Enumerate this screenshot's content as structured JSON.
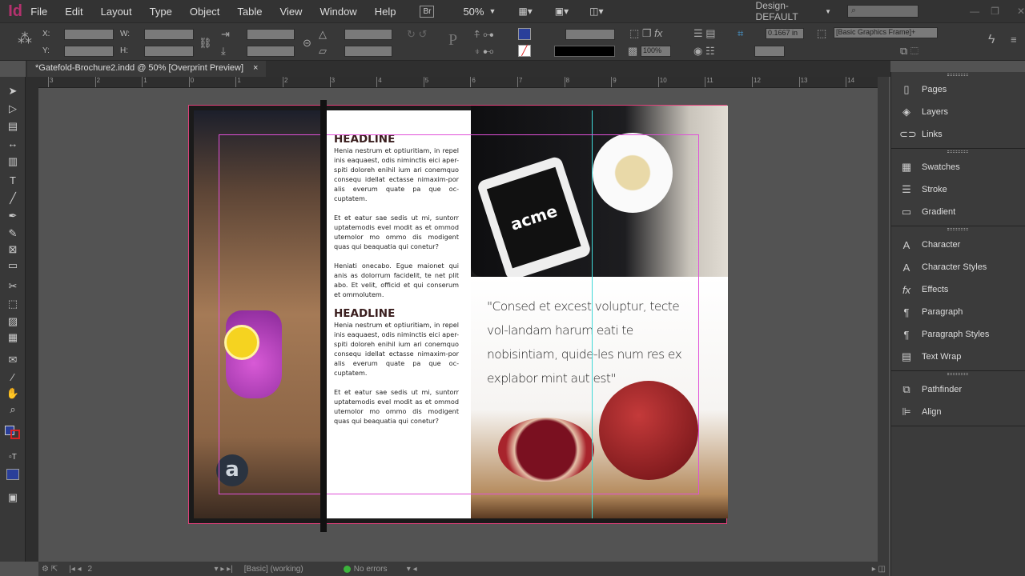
{
  "app": {
    "logo": "Id",
    "menus": [
      "File",
      "Edit",
      "Layout",
      "Type",
      "Object",
      "Table",
      "View",
      "Window",
      "Help"
    ],
    "bridge": "Br",
    "zoom": "50%",
    "workspace": "Design-DEFAULT",
    "search_placeholder": ""
  },
  "control": {
    "x_label": "X:",
    "y_label": "Y:",
    "w_label": "W:",
    "h_label": "H:",
    "stroke_weight": "",
    "opacity": "100%",
    "offset": "0.1667 in",
    "object_style": "[Basic Graphics Frame]+",
    "fill_color": "#2a3f9a"
  },
  "document": {
    "tab_title": "*Gatefold-Brochure2.indd @ 50% [Overprint Preview]",
    "close": "×"
  },
  "ruler": {
    "ticks": [
      "3",
      "2",
      "1",
      "0",
      "1",
      "2",
      "3",
      "4",
      "5",
      "6",
      "7",
      "8",
      "9",
      "10",
      "11",
      "12",
      "13",
      "14"
    ]
  },
  "panels": {
    "group1": [
      "Pages",
      "Layers",
      "Links"
    ],
    "group2": [
      "Swatches",
      "Stroke",
      "Gradient"
    ],
    "group3": [
      "Character",
      "Character Styles",
      "Effects",
      "Paragraph",
      "Paragraph Styles",
      "Text Wrap"
    ],
    "group4": [
      "Pathfinder",
      "Align"
    ]
  },
  "status": {
    "page": "2",
    "profile": "[Basic] (working)",
    "preflight": "No errors"
  },
  "content": {
    "headline1": "HEADLINE",
    "body1": [
      "Henia nestrum et optiuritiam, in repel inis eaquaest, odis niminctis eici aper-spiti doloreh enihil ium ari conemquo consequ idellat ectasse nimaxim-por alis everum quate pa que oc-cuptatem.",
      "Et et eatur sae sedis ut mi, suntorr uptatemodis evel modit as et ommod utemolor mo ommo dis modigent quas qui beaquatia qui conetur?",
      "Heniati onecabo. Egue maionet qui anis as dolorrum facidelit, te net plit abo. Et velit, officid et qui conserum et ommolutem."
    ],
    "headline2": "HEADLINE",
    "body2": [
      "Henia nestrum et optiuritiam, in repel inis eaquaest, odis niminctis eici aper-spiti doloreh enihil ium ari conemquo consequ idellat ectasse nimaxim-por alis everum quate pa que oc-cuptatem.",
      "Et et eatur sae sedis ut mi, suntorr uptatemodis evel modit as et ommod utemolor mo ommo dis modigent quas qui beaquatia qui conetur?"
    ],
    "quote": "\"Consed et excest voluptur, tecte vol-landam harum eati te nobisintiam, quide-les num res ex explabor mint aut est\"",
    "brand": "acme",
    "badge": "a"
  }
}
